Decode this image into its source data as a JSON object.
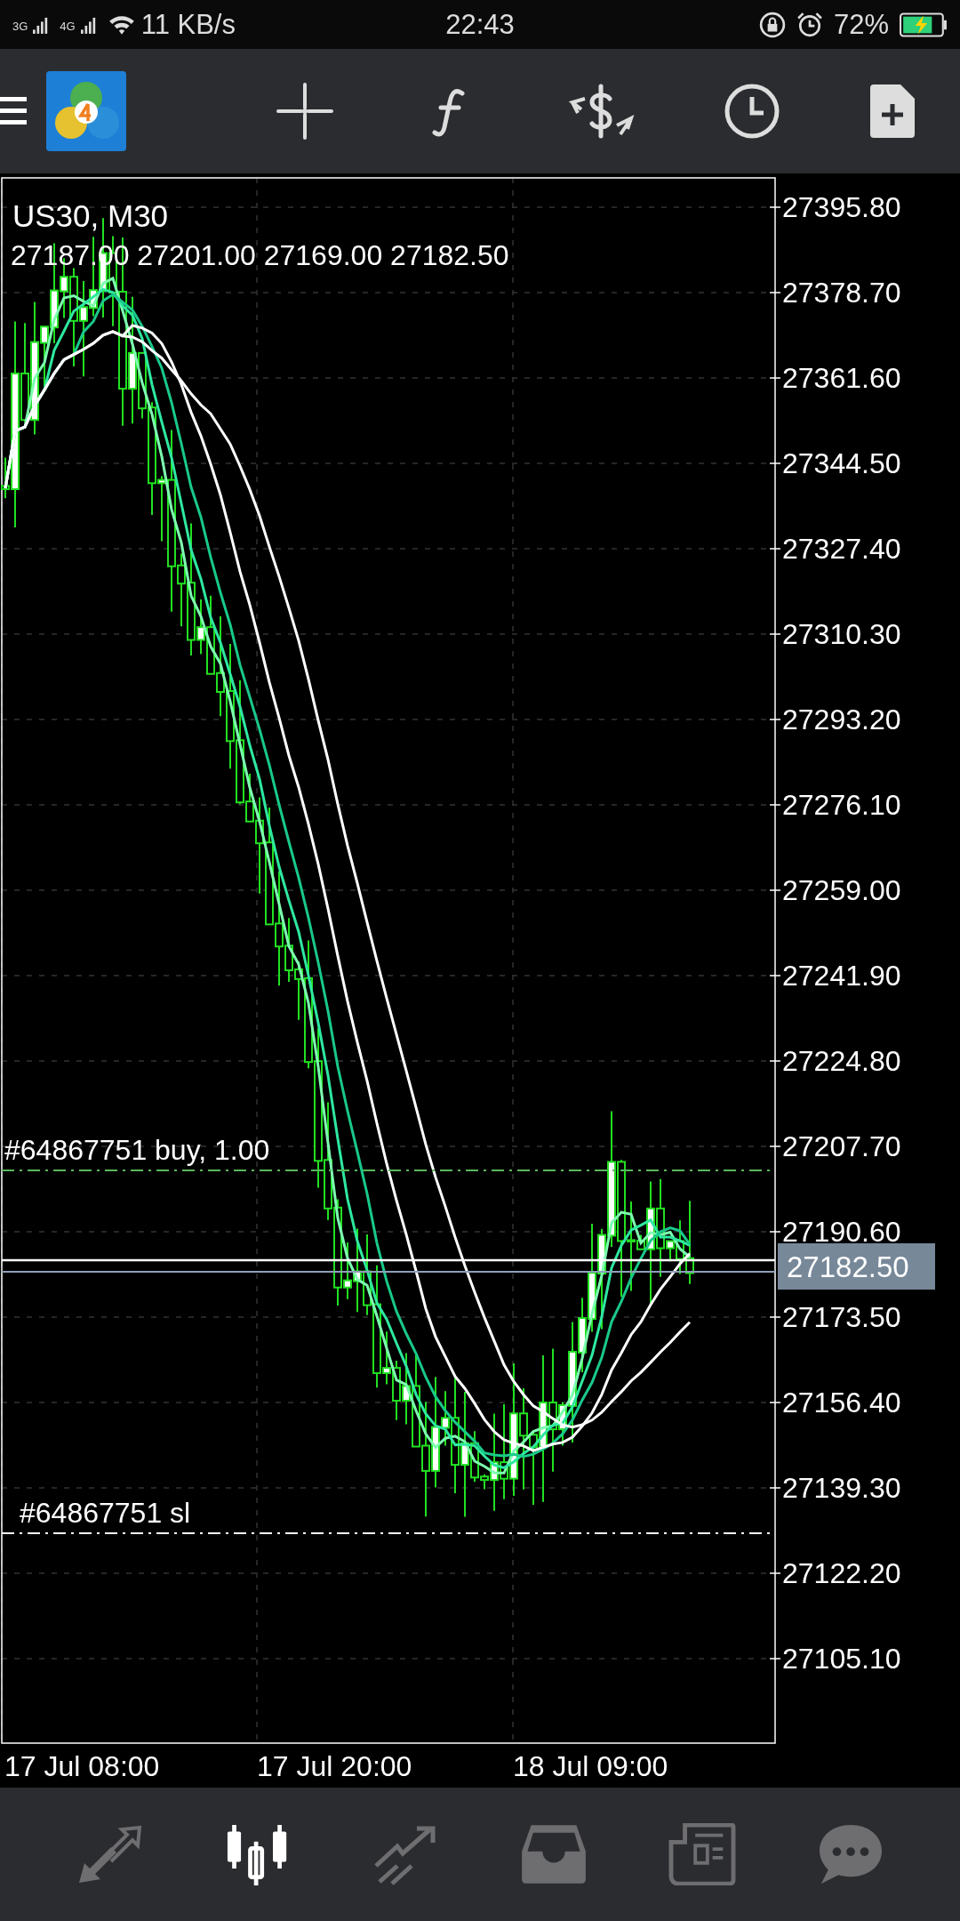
{
  "status_bar": {
    "network_1": "3G",
    "network_2": "4G",
    "speed": "11 KB/s",
    "time": "22:43",
    "battery": "72%",
    "charging": true
  },
  "toolbar": {
    "tools": [
      {
        "kind": "crosshair"
      },
      {
        "kind": "indicators"
      },
      {
        "kind": "trade"
      },
      {
        "kind": "period"
      },
      {
        "kind": "new-order"
      }
    ]
  },
  "chart": {
    "title": "US30, M30",
    "ohlc": "27187.00 27201.00 27169.00 27182.50",
    "price_labels": [
      "27395.80",
      "27378.70",
      "27361.60",
      "27344.50",
      "27327.40",
      "27310.30",
      "27293.20",
      "27276.10",
      "27259.00",
      "27241.90",
      "27224.80",
      "27207.70",
      "27190.60",
      "27173.50",
      "27156.40",
      "27139.30",
      "27122.20",
      "27105.10"
    ],
    "time_labels": [
      "17 Jul 08:00",
      "17 Jul 20:00",
      "18 Jul 09:00"
    ],
    "current_price": "27182.50",
    "order_lines": [
      {
        "kind": "buy",
        "label": "#64867751 buy, 1.00"
      },
      {
        "kind": "sl",
        "label": "#64867751 sl"
      }
    ]
  },
  "bottom_nav": [
    {
      "kind": "quotes",
      "selected": false
    },
    {
      "kind": "chart",
      "selected": true
    },
    {
      "kind": "trade",
      "selected": false
    },
    {
      "kind": "history",
      "selected": false
    },
    {
      "kind": "news",
      "selected": false
    },
    {
      "kind": "chat",
      "selected": false
    }
  ]
}
